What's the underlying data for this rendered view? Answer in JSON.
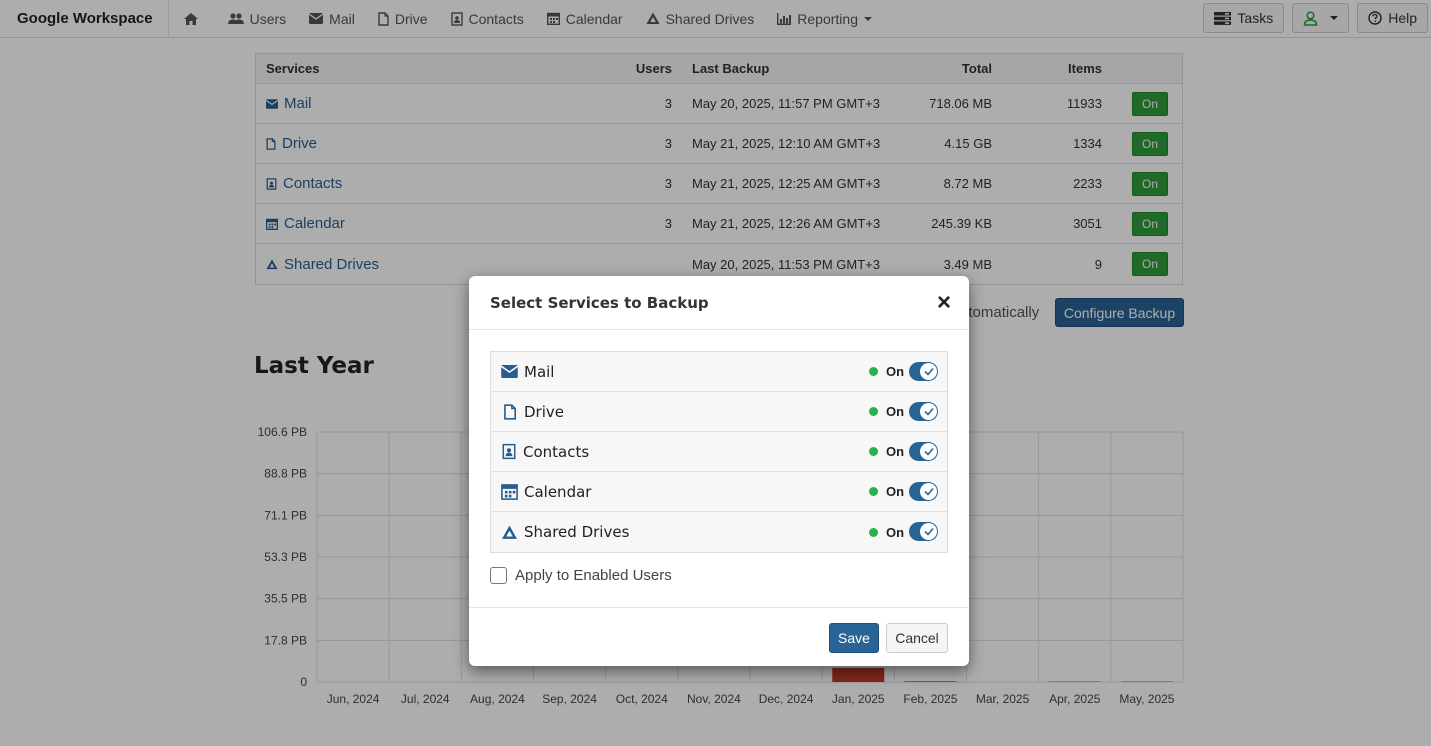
{
  "navbar": {
    "brand": "Google Workspace",
    "items": [
      {
        "label": "Users"
      },
      {
        "label": "Mail"
      },
      {
        "label": "Drive"
      },
      {
        "label": "Contacts"
      },
      {
        "label": "Calendar"
      },
      {
        "label": "Shared Drives"
      },
      {
        "label": "Reporting"
      }
    ],
    "tasks_label": "Tasks",
    "help_label": "Help"
  },
  "services_table": {
    "headers": {
      "services": "Services",
      "users": "Users",
      "last_backup": "Last Backup",
      "total": "Total",
      "items": "Items"
    },
    "rows": [
      {
        "name": "Mail",
        "users": "3",
        "last_backup": "May 20, 2025, 11:57 PM GMT+3",
        "total": "718.06 MB",
        "items": "11933",
        "status": "On"
      },
      {
        "name": "Drive",
        "users": "3",
        "last_backup": "May 21, 2025, 12:10 AM GMT+3",
        "total": "4.15 GB",
        "items": "1334",
        "status": "On"
      },
      {
        "name": "Contacts",
        "users": "3",
        "last_backup": "May 21, 2025, 12:25 AM GMT+3",
        "total": "8.72 MB",
        "items": "2233",
        "status": "On"
      },
      {
        "name": "Calendar",
        "users": "3",
        "last_backup": "May 21, 2025, 12:26 AM GMT+3",
        "total": "245.39 KB",
        "items": "3051",
        "status": "On"
      },
      {
        "name": "Shared Drives",
        "users": "",
        "last_backup": "May 20, 2025, 11:53 PM GMT+3",
        "total": "3.49 MB",
        "items": "9",
        "status": "On"
      }
    ]
  },
  "backup_row": {
    "auto_text": "utomatically",
    "configure_label": "Configure Backup"
  },
  "section_title": "Last Year",
  "chart_data": {
    "type": "bar",
    "categories": [
      "Jun, 2024",
      "Jul, 2024",
      "Aug, 2024",
      "Sep, 2024",
      "Oct, 2024",
      "Nov, 2024",
      "Dec, 2024",
      "Jan, 2025",
      "Feb, 2025",
      "Mar, 2025",
      "Apr, 2025",
      "May, 2025"
    ],
    "values": [
      0,
      0,
      0,
      0,
      0,
      0,
      0,
      6,
      0.3,
      0,
      0.3,
      0.3
    ],
    "series_colors": [
      "#cfd8e0",
      "#cfd8e0",
      "#cfd8e0",
      "#cfd8e0",
      "#cfd8e0",
      "#cfd8e0",
      "#cfd8e0",
      "#c0392b",
      "#c0392b",
      "#cfd8e0",
      "#7aa3c8",
      "#7aa3c8"
    ],
    "ytick_labels": [
      "0",
      "17.8 PB",
      "35.5 PB",
      "53.3 PB",
      "71.1 PB",
      "88.8 PB",
      "106.6 PB"
    ],
    "ylim": [
      0,
      106.6
    ],
    "grid": true
  },
  "modal": {
    "title": "Select Services to Backup",
    "close_label": "×",
    "services": [
      {
        "label": "Mail",
        "status": "On",
        "enabled": true
      },
      {
        "label": "Drive",
        "status": "On",
        "enabled": true
      },
      {
        "label": "Contacts",
        "status": "On",
        "enabled": true
      },
      {
        "label": "Calendar",
        "status": "On",
        "enabled": true
      },
      {
        "label": "Shared Drives",
        "status": "On",
        "enabled": true
      }
    ],
    "apply_label": "Apply to Enabled Users",
    "save_label": "Save",
    "cancel_label": "Cancel"
  },
  "colors": {
    "accent": "#2a6496",
    "on_badge": "#2e9d3a",
    "status_dot": "#28b24b"
  }
}
